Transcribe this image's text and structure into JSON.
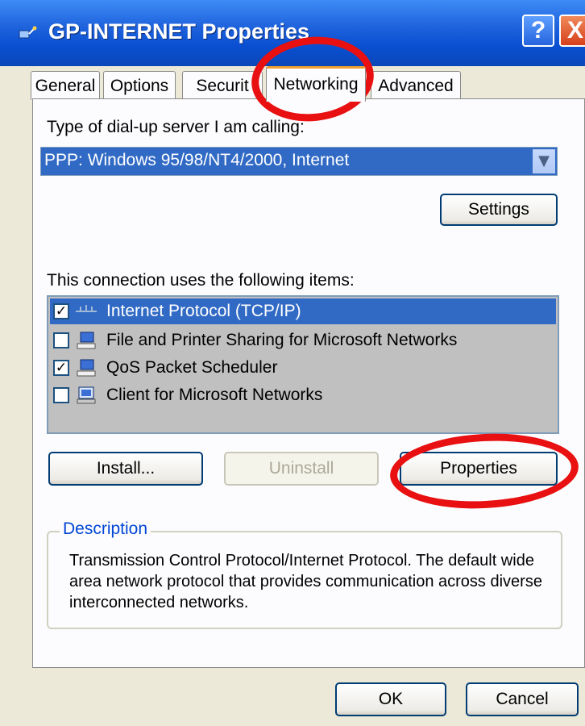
{
  "window": {
    "title": "GP-INTERNET Properties",
    "help_glyph": "?",
    "close_glyph": "X"
  },
  "tabs": [
    {
      "label": "General"
    },
    {
      "label": "Options"
    },
    {
      "label": "Securit"
    },
    {
      "label": "Networking",
      "active": true
    },
    {
      "label": "Advanced"
    }
  ],
  "networking": {
    "server_type_label": "Type of dial-up server I am calling:",
    "server_type_value": "PPP: Windows 95/98/NT4/2000, Internet",
    "settings_button": "Settings",
    "items_label": "This connection uses the following items:",
    "items": [
      {
        "label": "Internet Protocol (TCP/IP)",
        "checked": true,
        "selected": true,
        "icon": "network-protocol-icon"
      },
      {
        "label": "File and Printer Sharing for Microsoft Networks",
        "checked": false,
        "selected": false,
        "icon": "network-service-icon"
      },
      {
        "label": "QoS Packet Scheduler",
        "checked": true,
        "selected": false,
        "icon": "network-service-icon"
      },
      {
        "label": "Client for Microsoft Networks",
        "checked": false,
        "selected": false,
        "icon": "network-client-icon"
      }
    ],
    "install_button": "Install...",
    "uninstall_button": "Uninstall",
    "properties_button": "Properties",
    "description_label": "Description",
    "description_text": "Transmission Control Protocol/Internet Protocol. The default wide area network protocol that provides communication across diverse interconnected networks."
  },
  "footer": {
    "ok_button": "OK",
    "cancel_button": "Cancel"
  },
  "annotations": {
    "color": "#e81010"
  },
  "colors": {
    "titlebar": "#0a4fd1",
    "selection": "#316ac5",
    "dialog_bg": "#ece9d8"
  }
}
